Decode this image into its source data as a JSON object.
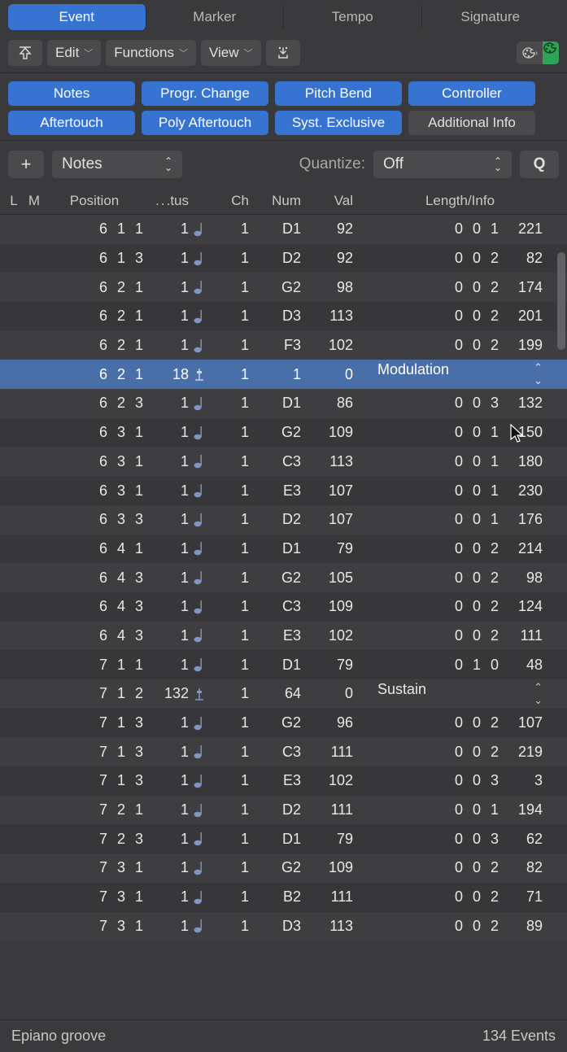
{
  "tabs": [
    "Event",
    "Marker",
    "Tempo",
    "Signature"
  ],
  "active_tab": 0,
  "toolbar": {
    "edit": "Edit",
    "functions": "Functions",
    "view": "View"
  },
  "filters": [
    {
      "label": "Notes",
      "on": true
    },
    {
      "label": "Progr. Change",
      "on": true
    },
    {
      "label": "Pitch Bend",
      "on": true
    },
    {
      "label": "Controller",
      "on": true
    },
    {
      "label": "Aftertouch",
      "on": true
    },
    {
      "label": "Poly Aftertouch",
      "on": true
    },
    {
      "label": "Syst. Exclusive",
      "on": true
    },
    {
      "label": "Additional Info",
      "on": false
    }
  ],
  "type_select": "Notes",
  "quantize_label": "Quantize:",
  "quantize_value": "Off",
  "q_button": "Q",
  "header": {
    "l": "L",
    "m": "M",
    "pos": "Position",
    "tus": ".tus",
    "ch": "Ch",
    "num": "Num",
    "val": "Val",
    "len": "Length/Info"
  },
  "rows": [
    {
      "pos": [
        "6",
        "1",
        "1"
      ],
      "tus": "1",
      "icon": "note",
      "ch": "1",
      "num": "D1",
      "val": "92",
      "len": [
        "0",
        "0",
        "1",
        "221"
      ]
    },
    {
      "pos": [
        "6",
        "1",
        "3"
      ],
      "tus": "1",
      "icon": "note",
      "ch": "1",
      "num": "D2",
      "val": "92",
      "len": [
        "0",
        "0",
        "2",
        "82"
      ]
    },
    {
      "pos": [
        "6",
        "2",
        "1"
      ],
      "tus": "1",
      "icon": "note",
      "ch": "1",
      "num": "G2",
      "val": "98",
      "len": [
        "0",
        "0",
        "2",
        "174"
      ]
    },
    {
      "pos": [
        "6",
        "2",
        "1"
      ],
      "tus": "1",
      "icon": "note",
      "ch": "1",
      "num": "D3",
      "val": "113",
      "len": [
        "0",
        "0",
        "2",
        "201"
      ]
    },
    {
      "pos": [
        "6",
        "2",
        "1"
      ],
      "tus": "1",
      "icon": "note",
      "ch": "1",
      "num": "F3",
      "val": "102",
      "len": [
        "0",
        "0",
        "2",
        "199"
      ]
    },
    {
      "pos": [
        "6",
        "2",
        "1"
      ],
      "tus": "18",
      "icon": "ctrl",
      "ch": "1",
      "num": "1",
      "val": "0",
      "info": "Modulation",
      "selected": true,
      "updown": true
    },
    {
      "pos": [
        "6",
        "2",
        "3"
      ],
      "tus": "1",
      "icon": "note",
      "ch": "1",
      "num": "D1",
      "val": "86",
      "len": [
        "0",
        "0",
        "3",
        "132"
      ]
    },
    {
      "pos": [
        "6",
        "3",
        "1"
      ],
      "tus": "1",
      "icon": "note",
      "ch": "1",
      "num": "G2",
      "val": "109",
      "len": [
        "0",
        "0",
        "1",
        "150"
      ]
    },
    {
      "pos": [
        "6",
        "3",
        "1"
      ],
      "tus": "1",
      "icon": "note",
      "ch": "1",
      "num": "C3",
      "val": "113",
      "len": [
        "0",
        "0",
        "1",
        "180"
      ]
    },
    {
      "pos": [
        "6",
        "3",
        "1"
      ],
      "tus": "1",
      "icon": "note",
      "ch": "1",
      "num": "E3",
      "val": "107",
      "len": [
        "0",
        "0",
        "1",
        "230"
      ]
    },
    {
      "pos": [
        "6",
        "3",
        "3"
      ],
      "tus": "1",
      "icon": "note",
      "ch": "1",
      "num": "D2",
      "val": "107",
      "len": [
        "0",
        "0",
        "1",
        "176"
      ]
    },
    {
      "pos": [
        "6",
        "4",
        "1"
      ],
      "tus": "1",
      "icon": "note",
      "ch": "1",
      "num": "D1",
      "val": "79",
      "len": [
        "0",
        "0",
        "2",
        "214"
      ]
    },
    {
      "pos": [
        "6",
        "4",
        "3"
      ],
      "tus": "1",
      "icon": "note",
      "ch": "1",
      "num": "G2",
      "val": "105",
      "len": [
        "0",
        "0",
        "2",
        "98"
      ]
    },
    {
      "pos": [
        "6",
        "4",
        "3"
      ],
      "tus": "1",
      "icon": "note",
      "ch": "1",
      "num": "C3",
      "val": "109",
      "len": [
        "0",
        "0",
        "2",
        "124"
      ]
    },
    {
      "pos": [
        "6",
        "4",
        "3"
      ],
      "tus": "1",
      "icon": "note",
      "ch": "1",
      "num": "E3",
      "val": "102",
      "len": [
        "0",
        "0",
        "2",
        "111"
      ]
    },
    {
      "pos": [
        "7",
        "1",
        "1"
      ],
      "tus": "1",
      "icon": "note",
      "ch": "1",
      "num": "D1",
      "val": "79",
      "len": [
        "0",
        "1",
        "0",
        "48"
      ]
    },
    {
      "pos": [
        "7",
        "1",
        "2"
      ],
      "tus": "132",
      "icon": "ctrl",
      "ch": "1",
      "num": "64",
      "val": "0",
      "info": "Sustain",
      "updown": true
    },
    {
      "pos": [
        "7",
        "1",
        "3"
      ],
      "tus": "1",
      "icon": "note",
      "ch": "1",
      "num": "G2",
      "val": "96",
      "len": [
        "0",
        "0",
        "2",
        "107"
      ]
    },
    {
      "pos": [
        "7",
        "1",
        "3"
      ],
      "tus": "1",
      "icon": "note",
      "ch": "1",
      "num": "C3",
      "val": "111",
      "len": [
        "0",
        "0",
        "2",
        "219"
      ]
    },
    {
      "pos": [
        "7",
        "1",
        "3"
      ],
      "tus": "1",
      "icon": "note",
      "ch": "1",
      "num": "E3",
      "val": "102",
      "len": [
        "0",
        "0",
        "3",
        "3"
      ]
    },
    {
      "pos": [
        "7",
        "2",
        "1"
      ],
      "tus": "1",
      "icon": "note",
      "ch": "1",
      "num": "D2",
      "val": "111",
      "len": [
        "0",
        "0",
        "1",
        "194"
      ]
    },
    {
      "pos": [
        "7",
        "2",
        "3"
      ],
      "tus": "1",
      "icon": "note",
      "ch": "1",
      "num": "D1",
      "val": "79",
      "len": [
        "0",
        "0",
        "3",
        "62"
      ]
    },
    {
      "pos": [
        "7",
        "3",
        "1"
      ],
      "tus": "1",
      "icon": "note",
      "ch": "1",
      "num": "G2",
      "val": "109",
      "len": [
        "0",
        "0",
        "2",
        "82"
      ]
    },
    {
      "pos": [
        "7",
        "3",
        "1"
      ],
      "tus": "1",
      "icon": "note",
      "ch": "1",
      "num": "B2",
      "val": "111",
      "len": [
        "0",
        "0",
        "2",
        "71"
      ]
    },
    {
      "pos": [
        "7",
        "3",
        "1"
      ],
      "tus": "1",
      "icon": "note",
      "ch": "1",
      "num": "D3",
      "val": "113",
      "len": [
        "0",
        "0",
        "2",
        "89"
      ]
    }
  ],
  "footer": {
    "left": "Epiano groove",
    "right": "134 Events"
  }
}
